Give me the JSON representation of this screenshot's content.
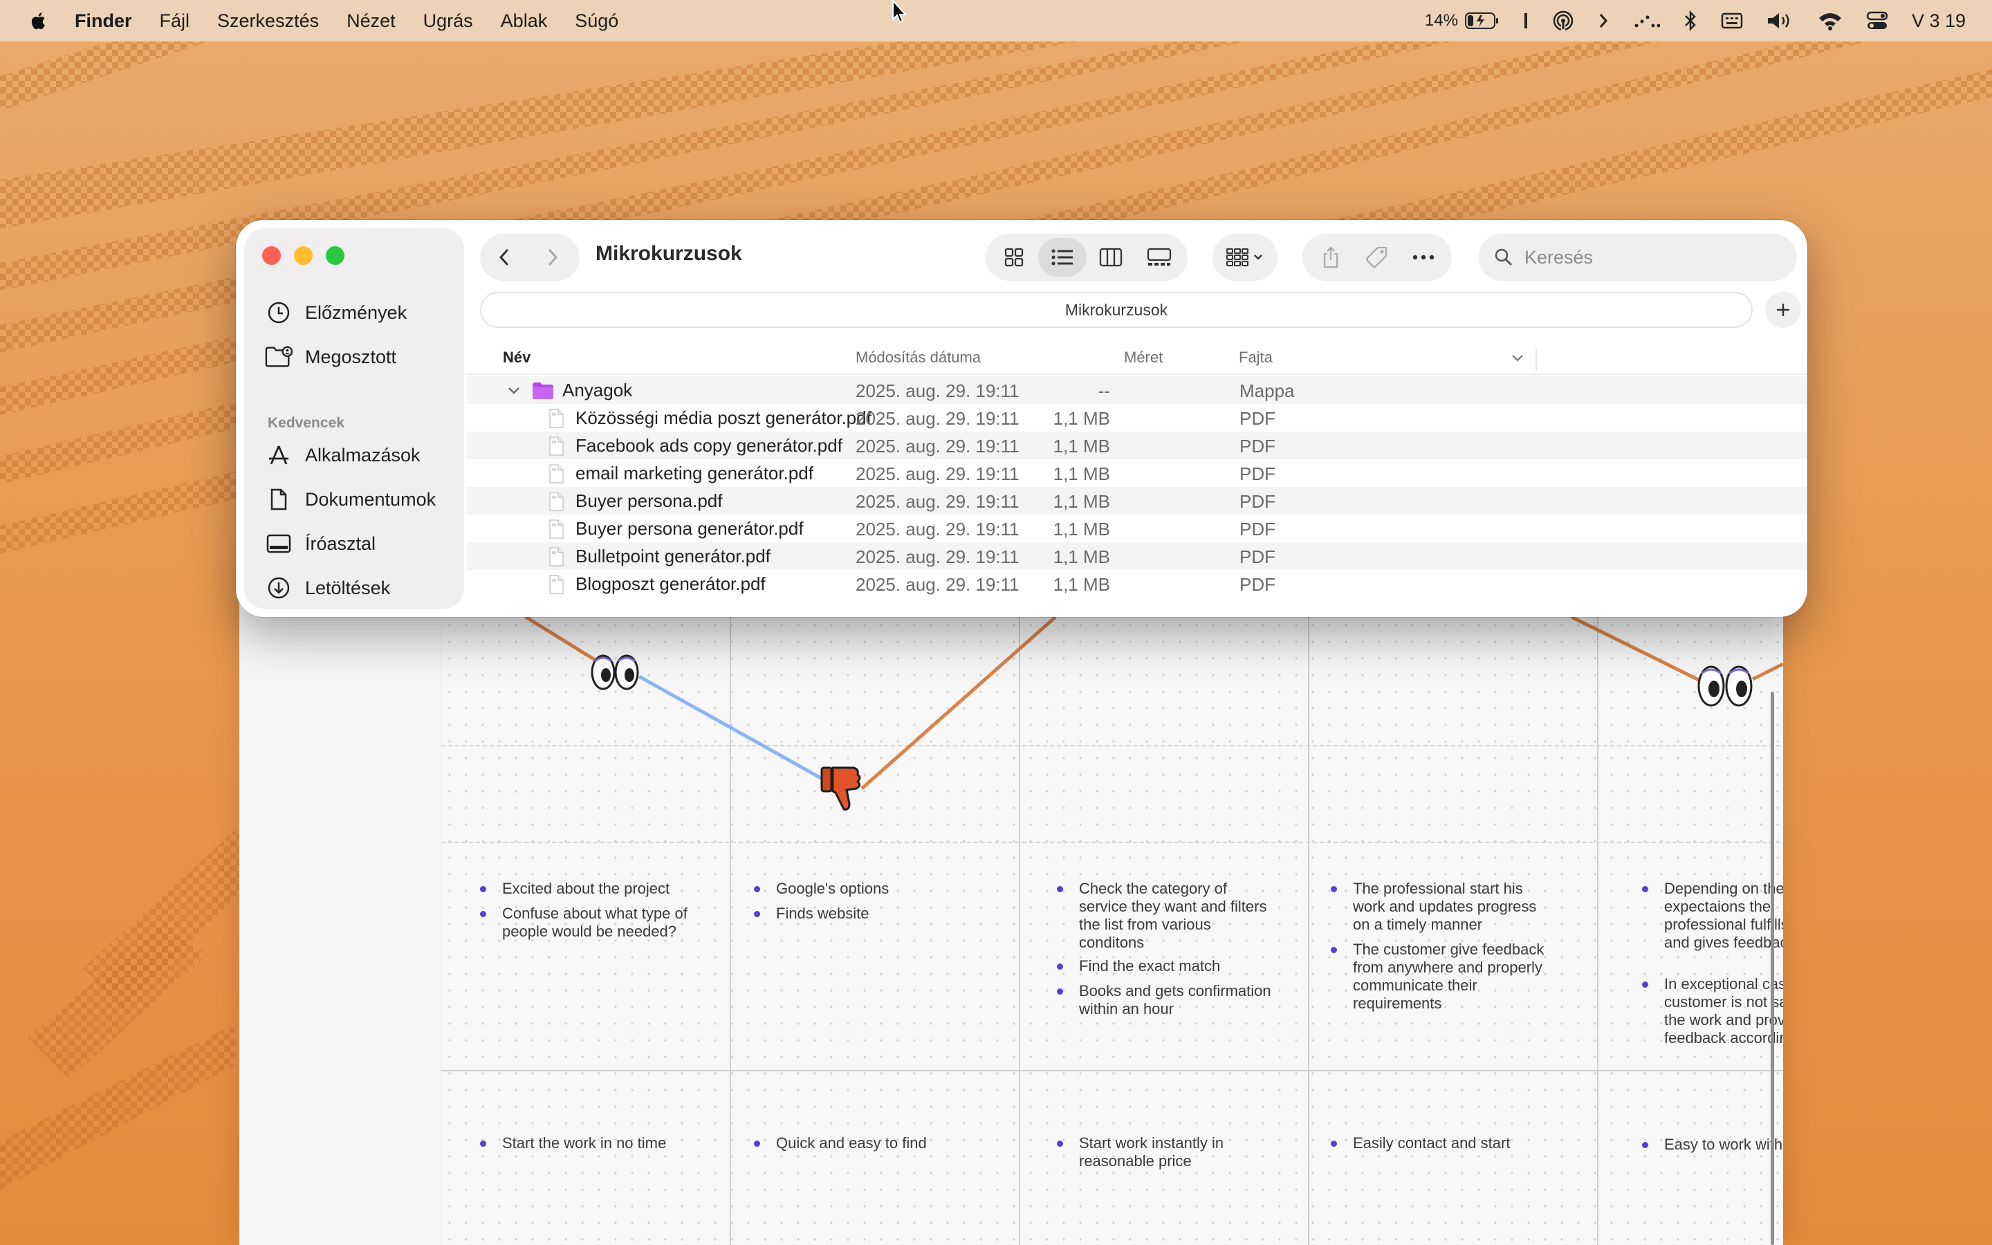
{
  "menubar": {
    "apple_icon": "apple-logo-icon",
    "app_name": "Finder",
    "menus": [
      "Fájl",
      "Szerkesztés",
      "Nézet",
      "Ugrás",
      "Ablak",
      "Súgó"
    ],
    "battery_percent": "14%",
    "clock": "V 3 19",
    "status_icons": [
      "battery-icon",
      "text-cursor-icon",
      "airdrop-icon",
      "chevron-right-icon",
      "dots-icon",
      "bluetooth-icon",
      "keyboard-icon",
      "volume-icon",
      "wifi-icon",
      "control-center-icon"
    ]
  },
  "finder": {
    "window_title": "Mikrokurzusok",
    "path": "Mikrokurzusok",
    "search_placeholder": "Keresés",
    "view_buttons": [
      "icon-view-icon",
      "list-view-icon",
      "column-view-icon",
      "gallery-view-icon"
    ],
    "selected_view": "list",
    "sidebar": {
      "items_top": [
        {
          "label": "Előzmények",
          "icon": "clock-icon"
        },
        {
          "label": "Megosztott",
          "icon": "shared-folder-icon"
        }
      ],
      "section_title": "Kedvencek",
      "favorites": [
        {
          "label": "Alkalmazások",
          "icon": "applications-icon"
        },
        {
          "label": "Dokumentumok",
          "icon": "document-icon"
        },
        {
          "label": "Íróasztal",
          "icon": "desktop-icon"
        },
        {
          "label": "Letöltések",
          "icon": "download-icon"
        }
      ]
    },
    "columns": {
      "name": "Név",
      "modified": "Módosítás dátuma",
      "size": "Méret",
      "kind": "Fajta"
    },
    "rows": [
      {
        "name": "Anyagok",
        "date": "2025. aug. 29. 19:11",
        "size": "--",
        "kind": "Mappa",
        "type": "folder",
        "expanded": true
      },
      {
        "name": "Közösségi média poszt generátor.pdf",
        "date": "2025. aug. 29. 19:11",
        "size": "1,1 MB",
        "kind": "PDF",
        "type": "file"
      },
      {
        "name": "Facebook ads copy generátor.pdf",
        "date": "2025. aug. 29. 19:11",
        "size": "1,1 MB",
        "kind": "PDF",
        "type": "file"
      },
      {
        "name": "email marketing generátor.pdf",
        "date": "2025. aug. 29. 19:11",
        "size": "1,1 MB",
        "kind": "PDF",
        "type": "file"
      },
      {
        "name": "Buyer persona.pdf",
        "date": "2025. aug. 29. 19:11",
        "size": "1,1 MB",
        "kind": "PDF",
        "type": "file"
      },
      {
        "name": "Buyer persona generátor.pdf",
        "date": "2025. aug. 29. 19:11",
        "size": "1,1 MB",
        "kind": "PDF",
        "type": "file"
      },
      {
        "name": "Bulletpoint generátor.pdf",
        "date": "2025. aug. 29. 19:11",
        "size": "1,1 MB",
        "kind": "PDF",
        "type": "file"
      },
      {
        "name": "Blogposzt generátor.pdf",
        "date": "2025. aug. 29. 19:11",
        "size": "1,1 MB",
        "kind": "PDF",
        "type": "file"
      }
    ]
  },
  "background_doc": {
    "columns": [
      {
        "thoughts": [
          "Excited about the project",
          "Confuse about what type of people would be needed?"
        ],
        "outcome": "Start the work in no time"
      },
      {
        "thoughts": [
          "Google's options",
          "Finds website"
        ],
        "outcome": "Quick and easy to find"
      },
      {
        "thoughts": [
          "Check the category of service they want and filters the list from various conditons",
          "Find the exact match",
          "Books and gets confirmation within an hour"
        ],
        "outcome": "Start work instantly in reasonable price"
      },
      {
        "thoughts": [
          "The professional start his work and updates progress on a timely manner",
          "The customer give feedback from anywhere and properly communicate their requirements"
        ],
        "outcome": "Easily contact and start"
      },
      {
        "thoughts": [
          "Depending on the expectaions the professional fulfills t and gives feedback job",
          "In exceptional cases customer is not satif the work and provid feedback according"
        ],
        "outcome": "Easy to work with"
      }
    ],
    "emojis": [
      "eyes-icon",
      "thumbs-down-icon",
      "eyes-icon"
    ]
  },
  "colors": {
    "desktop": "#e89a4f",
    "close": "#ff5f57",
    "minimize": "#febc2e",
    "zoom": "#28c840",
    "folder": "#b648e6",
    "accent_dot": "#5b3cd6",
    "line_orange": "#d9834a",
    "line_blue": "#8fb3f2"
  }
}
